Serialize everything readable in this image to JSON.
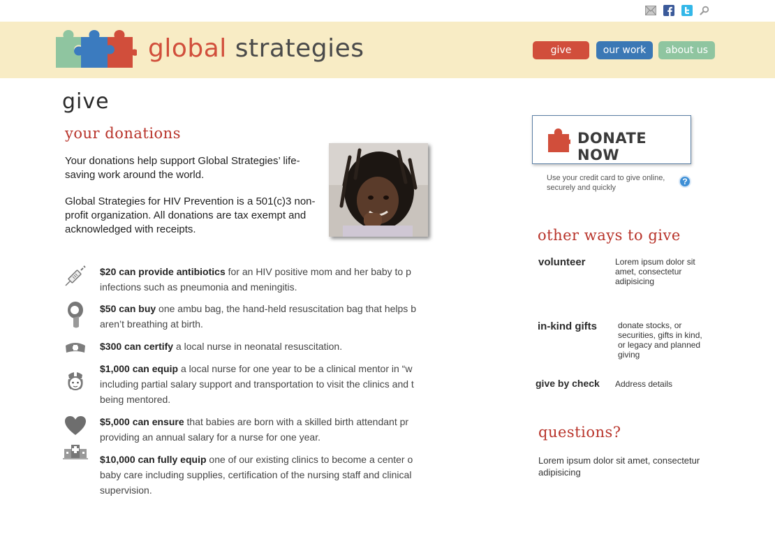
{
  "utility_icons": [
    "mail-icon",
    "facebook-icon",
    "twitter-icon",
    "search-icon"
  ],
  "brand": {
    "word1": "global",
    "word2": "strategies",
    "colors": {
      "red": "#d14e3b",
      "green": "#8fc5a0",
      "blue": "#3b7bbf",
      "header_bg": "#f8ecc5"
    }
  },
  "nav": {
    "give": "give",
    "our_work": "our work",
    "about_us": "about us",
    "colors": {
      "give": "#d14e3b",
      "our_work": "#3b78b5",
      "about_us": "#8fc5a0"
    }
  },
  "page_title": "give",
  "donations": {
    "heading": "your donations",
    "paragraphs": [
      "Your donations help support Global Strategies’ life-saving work around the world.",
      "Global Strategies for HIV Prevention is a 501(c)3 non-profit organization. All donations are tax exempt and acknowledged with receipts."
    ]
  },
  "tiers": [
    {
      "icon": "syringe-icon",
      "bold": "$20 can provide antibiotics",
      "text": " for an HIV positive mom and her baby to prevent infections such as pneumonia and meningitis.",
      "line1": "$20 can provide antibiotics for an HIV positive mom and her baby to p",
      "line2": "infections such as pneumonia and meningitis."
    },
    {
      "icon": "ambu-bag-icon",
      "bold": "$50 can buy",
      "line1_rest": " one ambu bag, the hand-held resuscitation bag that helps b",
      "line2": "aren’t breathing at birth."
    },
    {
      "icon": "nurse-cap-icon",
      "bold": "$300 can certify",
      "line1_rest": " a local nurse in neonatal resuscitation."
    },
    {
      "icon": "nurse-icon",
      "bold": "$1,000 can equip",
      "line1_rest": " a local nurse for one year to be a clinical mentor in “w",
      "line2": "including partial salary support and transportation to visit the clinics and t",
      "line3": "being mentored."
    },
    {
      "icon": "heart-icon",
      "bold": "$5,000 can ensure",
      "line1_rest": " that babies are born with a skilled birth attendant pr",
      "line2": "providing an annual salary for a nurse for one year."
    },
    {
      "icon": "hospital-icon",
      "bold": "$10,000 can fully equip",
      "line1_rest": " one of our existing clinics to become a center o",
      "line2": "baby care including supplies, certification of the nursing staff and clinical",
      "line3": "supervision."
    }
  ],
  "donate": {
    "button_label": "DONATE NOW",
    "note": "Use your credit card to give online, securely and quickly",
    "help": "?"
  },
  "other_ways": {
    "heading": "other ways to give",
    "items": [
      {
        "label": "volunteer",
        "desc": "Lorem ipsum dolor sit amet, consectetur adipisicing"
      },
      {
        "label": "in-kind gifts",
        "desc": "donate stocks, or securities, gifts in kind, or legacy and planned giving"
      },
      {
        "label": "give by check",
        "desc": "Address details"
      }
    ]
  },
  "questions": {
    "heading": "questions?",
    "text": "Lorem ipsum dolor sit amet, consectetur adipisicing"
  }
}
